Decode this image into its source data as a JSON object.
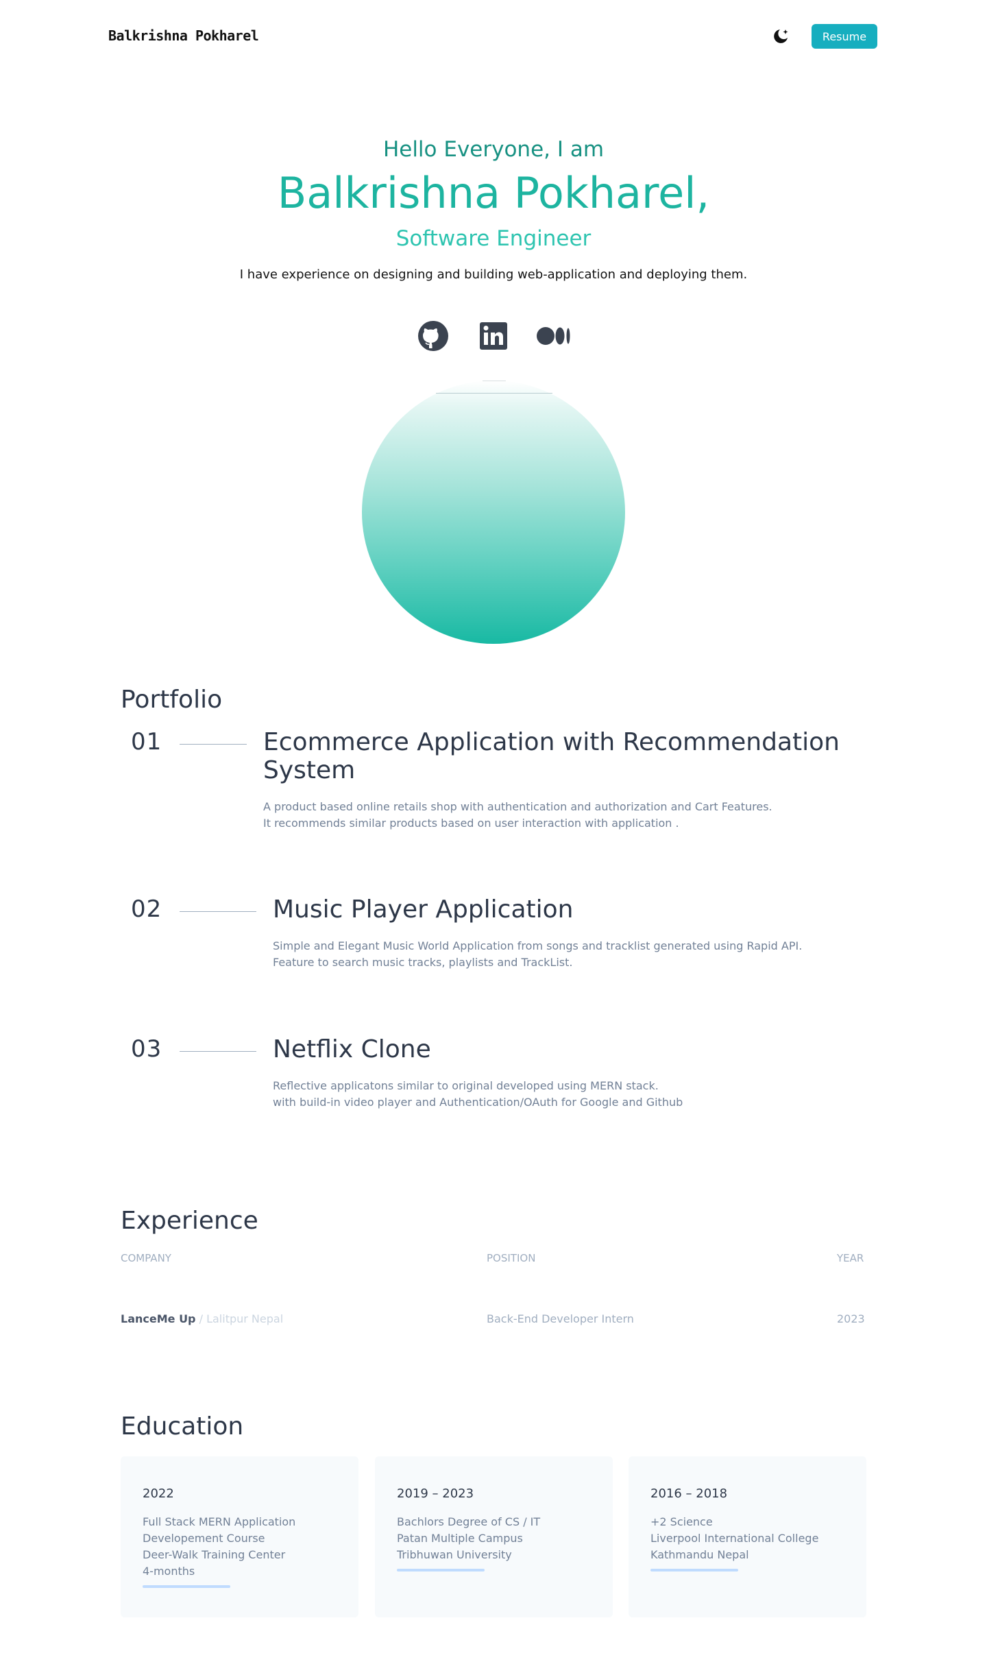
{
  "header": {
    "logo_first": "Balkrishna",
    "logo_last": "Pokharel",
    "theme_toggle_icon": "moon-icon",
    "resume_label": "Resume",
    "accent": "#16aebf"
  },
  "hero": {
    "greeting": "Hello Everyone, I am",
    "name": "Balkrishna Pokharel,",
    "role": "Software Engineer",
    "description": "I have experience on designing and building web-application and deploying them.",
    "socials": [
      {
        "icon": "github-icon"
      },
      {
        "icon": "linkedin-icon"
      },
      {
        "icon": "medium-icon"
      }
    ],
    "name_color": "#1db4a0"
  },
  "portfolio": {
    "title": "Portfolio",
    "projects": [
      {
        "number": "01",
        "title_line1": "Ecommerce Application with Recommendation",
        "title_line2": "System",
        "desc_line1": "A product based online retails shop with authentication and authorization and Cart Features.",
        "desc_line2": "It recommends similar products based on user interaction with application ."
      },
      {
        "number": "02",
        "title_line1": "Music Player Application",
        "desc_line1": "Simple and Elegant Music World Application from songs and tracklist generated using Rapid API.",
        "desc_line2": "Feature to search music tracks, playlists and TrackList."
      },
      {
        "number": "03",
        "title_line1": "Netflix Clone",
        "desc_line1": "Reflective applicatons similar to original developed using MERN stack.",
        "desc_line2": "with build-in video player and Authentication/OAuth for Google and Github"
      }
    ]
  },
  "experience": {
    "title": "Experience",
    "columns": [
      "Company",
      "Position",
      "Year"
    ],
    "rows": [
      {
        "company": "LanceMe Up",
        "location": " / Lalitpur Nepal",
        "position": "Back-End Developer Intern",
        "year": "2023"
      }
    ]
  },
  "education": {
    "title": "Education",
    "cards": [
      {
        "year": "2022",
        "lines": [
          "Full Stack MERN Application",
          "Developement Course",
          "Deer-Walk Training Center",
          "4-months"
        ]
      },
      {
        "year": "2019 – 2023",
        "lines": [
          "Bachlors Degree of CS / IT",
          "Patan Multiple Campus",
          "Tribhuwan University"
        ]
      },
      {
        "year": "2016 – 2018",
        "lines": [
          "+2 Science",
          "Liverpool International College",
          "Kathmandu Nepal"
        ]
      }
    ]
  }
}
